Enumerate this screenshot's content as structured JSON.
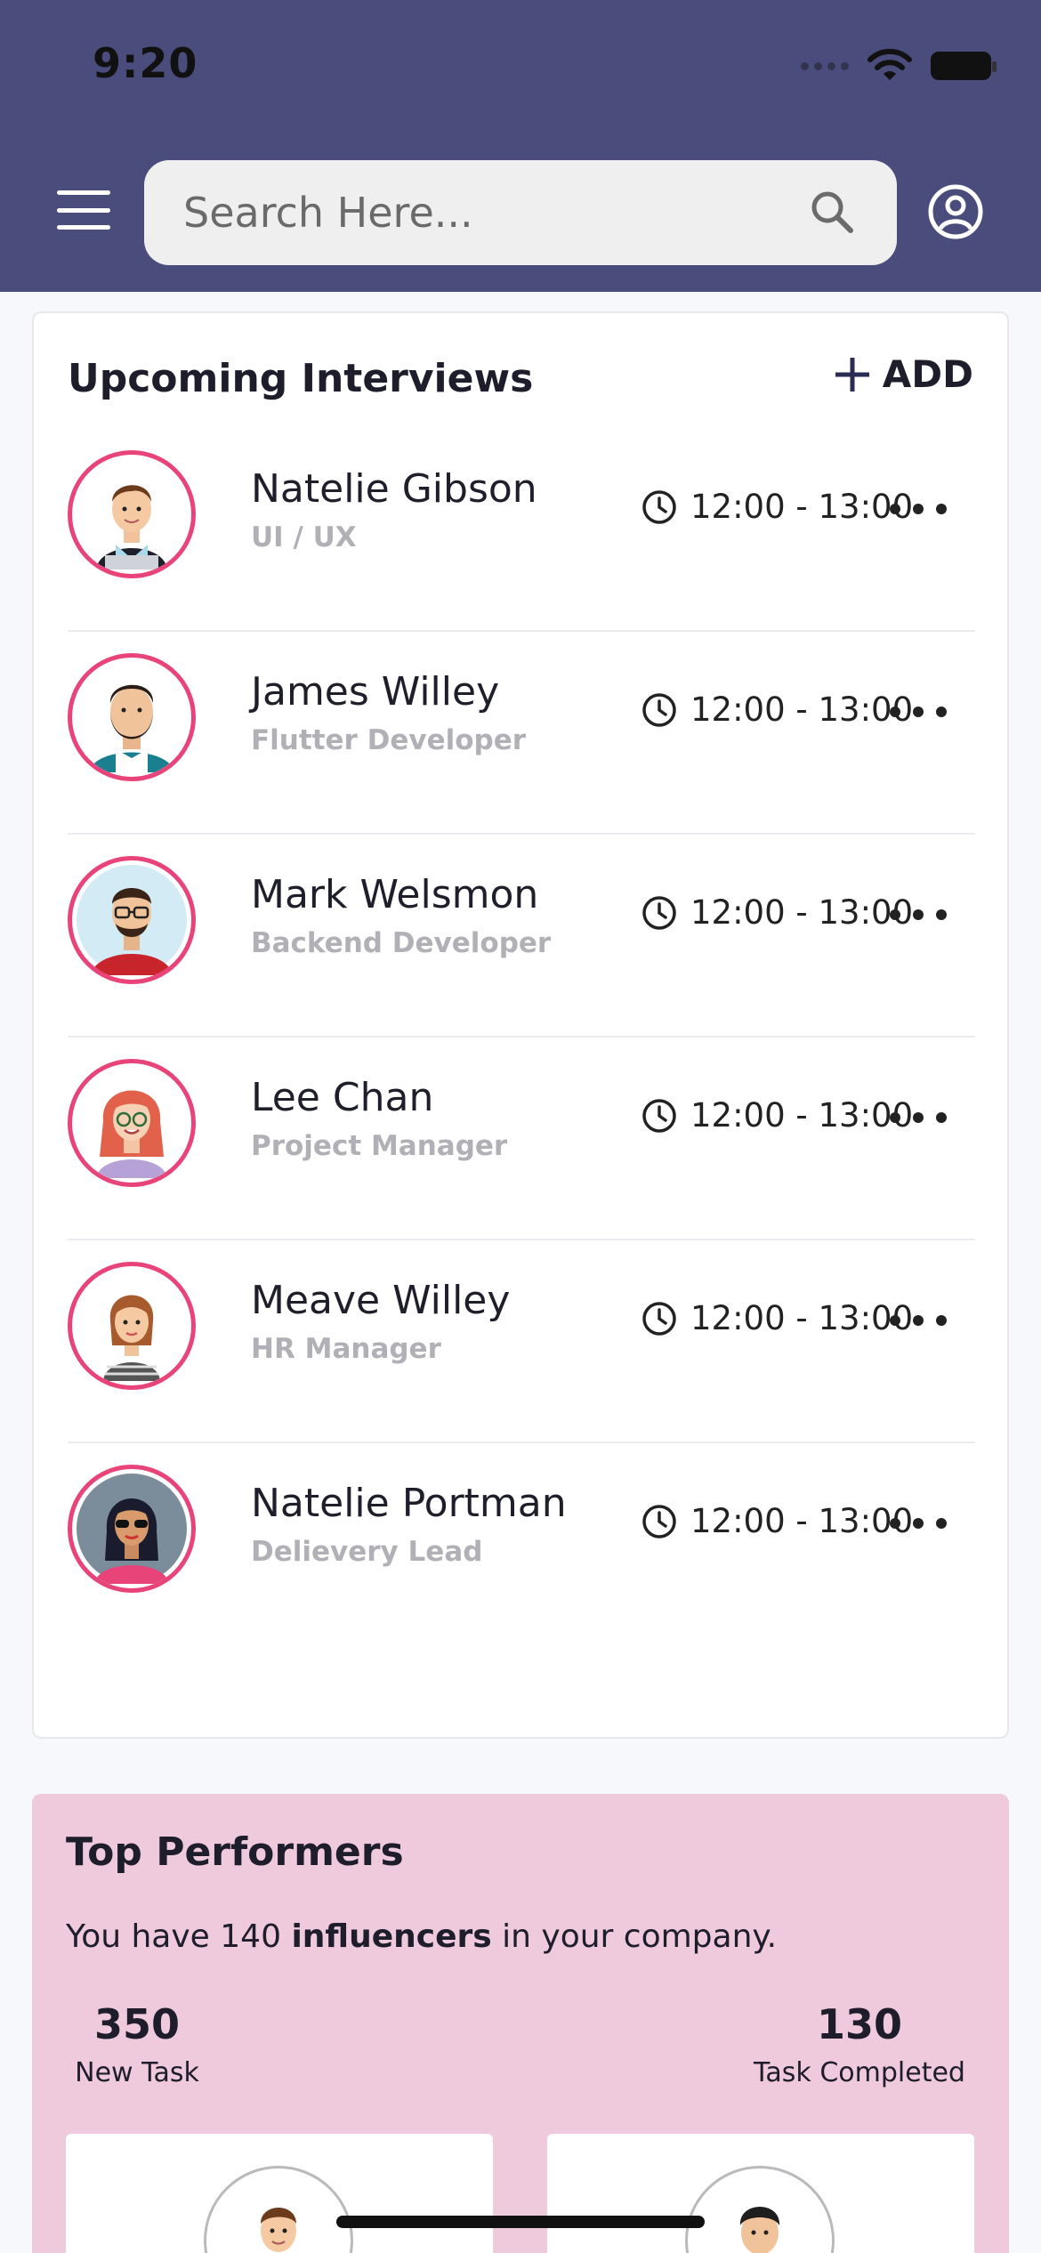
{
  "status": {
    "time": "9:20"
  },
  "header": {
    "search_placeholder": "Search Here...",
    "bg_color": "#4a4c7c"
  },
  "interviews": {
    "title": "Upcoming Interviews",
    "add_label": "ADD",
    "items": [
      {
        "name": "Natelie Gibson",
        "role": "UI / UX",
        "time": "12:00 - 13:00",
        "avatar_icon": "man-laptop-avatar"
      },
      {
        "name": "James Willey",
        "role": "Flutter Developer",
        "time": "12:00 - 13:00",
        "avatar_icon": "bearded-man-avatar"
      },
      {
        "name": "Mark Welsmon",
        "role": "Backend Developer",
        "time": "12:00 - 13:00",
        "avatar_icon": "man-glasses-avatar"
      },
      {
        "name": "Lee Chan",
        "role": "Project Manager",
        "time": "12:00 - 13:00",
        "avatar_icon": "redhead-woman-avatar"
      },
      {
        "name": "Meave Willey",
        "role": "HR Manager",
        "time": "12:00 - 13:00",
        "avatar_icon": "woman-avatar"
      },
      {
        "name": "Natelie Portman",
        "role": "Delievery Lead",
        "time": "12:00 - 13:00",
        "avatar_icon": "woman-sunglasses-avatar"
      }
    ]
  },
  "performers": {
    "title": "Top Performers",
    "text_prefix": "You have 140 ",
    "text_bold": "influencers",
    "text_suffix": " in your company.",
    "new_task_value": "350",
    "new_task_label": "New Task",
    "completed_value": "130",
    "completed_label": "Task Completed",
    "bg_color": "#efc9dc"
  },
  "accent_color": "#e8447a"
}
